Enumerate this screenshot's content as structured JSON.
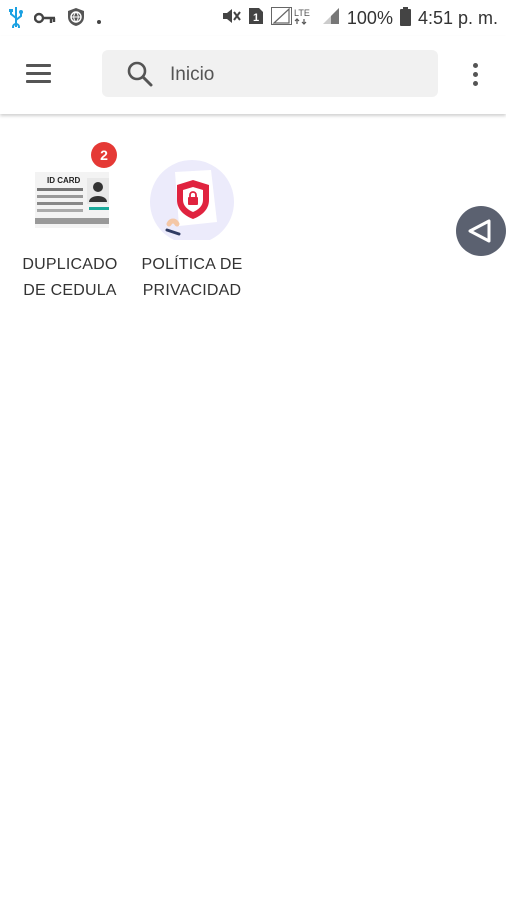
{
  "status_bar": {
    "battery": "100%",
    "time": "4:51 p. m.",
    "network": "LTE",
    "sim": "1"
  },
  "app_bar": {
    "search_placeholder": "Inicio"
  },
  "grid": {
    "items": [
      {
        "label_line1": "DUPLICADO",
        "label_line2": "DE CEDULA",
        "badge": "2",
        "card_text": "ID CARD"
      },
      {
        "label_line1": "POLÍTICA DE",
        "label_line2": "PRIVACIDAD"
      }
    ]
  },
  "colors": {
    "badge": "#e53935",
    "fab": "#5b6170",
    "shield": "#e0233f",
    "status_usb": "#1ba1e2"
  },
  "icons": {
    "menu": "hamburger-icon",
    "search": "search-icon",
    "more": "more-vert-icon",
    "back": "triangle-left-icon"
  }
}
